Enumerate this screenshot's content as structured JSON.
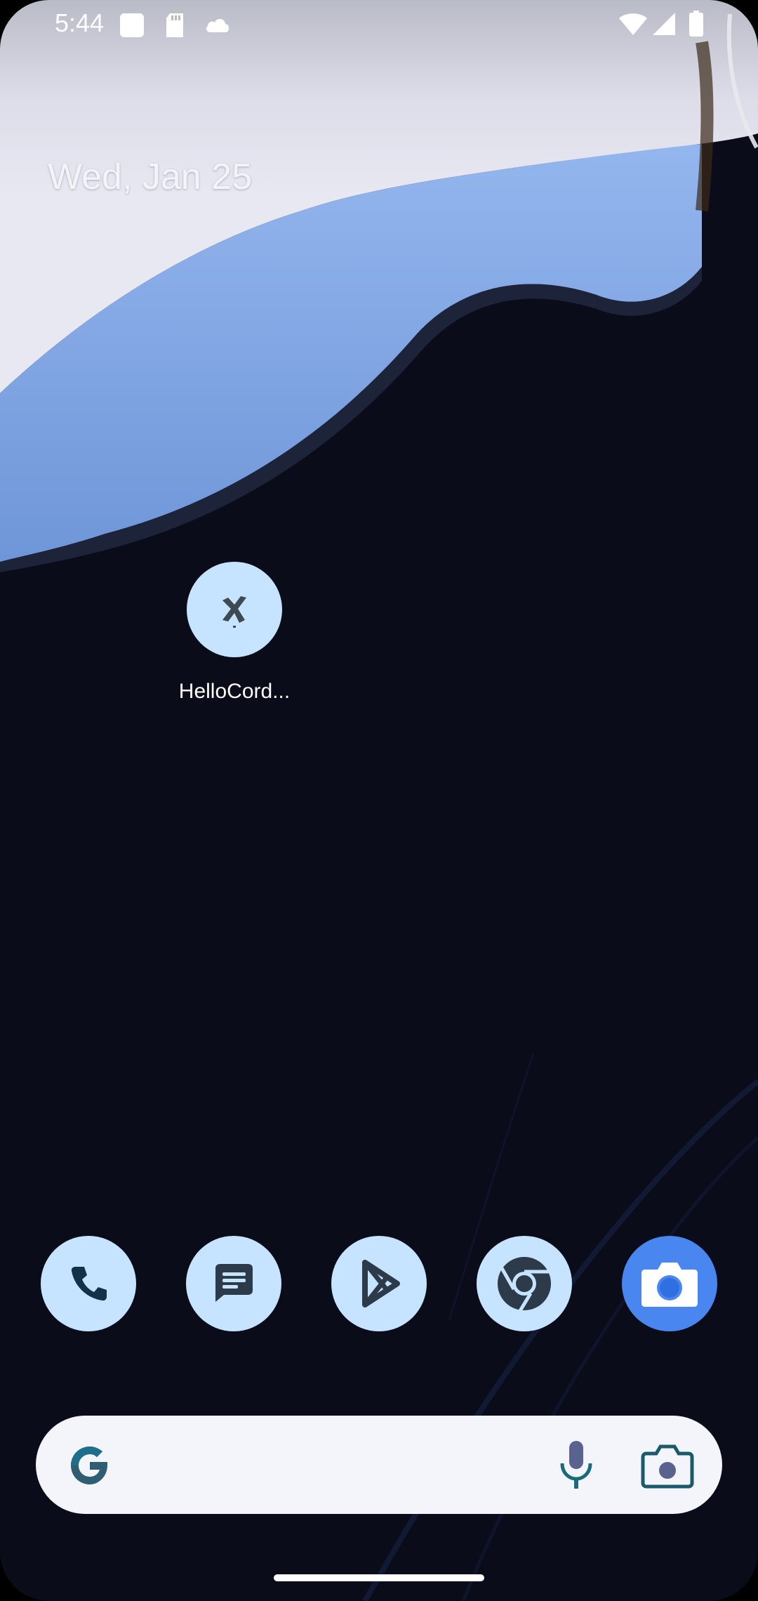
{
  "status_bar": {
    "time": "5:44",
    "left_icons": [
      "app-square-icon",
      "sd-card-icon",
      "cloud-icon"
    ],
    "right_icons": [
      "wifi-icon",
      "cellular-signal-icon",
      "battery-icon"
    ]
  },
  "home": {
    "date": "Wed, Jan 25",
    "apps": [
      {
        "label": "HelloCord...",
        "icon": "hellocordova-icon"
      }
    ]
  },
  "dock": {
    "apps": [
      {
        "name": "Phone",
        "icon": "phone-icon"
      },
      {
        "name": "Messages",
        "icon": "messages-icon"
      },
      {
        "name": "Play Store",
        "icon": "play-store-icon"
      },
      {
        "name": "Chrome",
        "icon": "chrome-icon"
      },
      {
        "name": "Camera",
        "icon": "camera-icon"
      }
    ]
  },
  "search_bar": {
    "icons": [
      "google-g-icon",
      "microphone-icon",
      "lens-icon"
    ]
  },
  "colors": {
    "icon_background": "#c6e3ff",
    "camera_background": "#4a86f0",
    "wallpaper_dark": "#0a0c1a",
    "wallpaper_blue": "#8fb3ec"
  }
}
